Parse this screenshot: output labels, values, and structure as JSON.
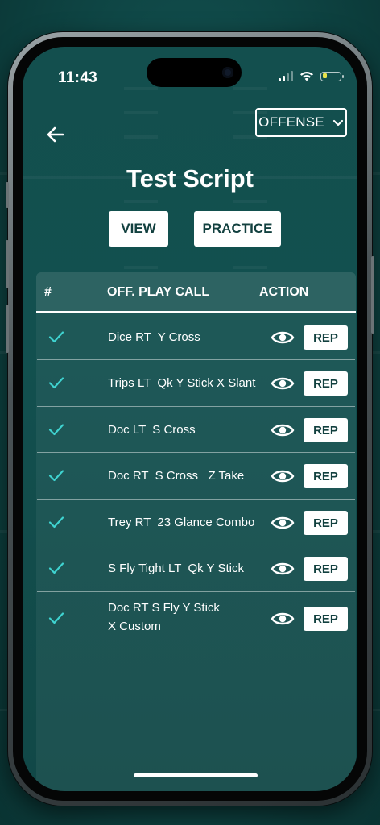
{
  "status_bar": {
    "time": "11:43"
  },
  "header": {
    "back_icon": "arrow-left-icon",
    "mode_select": {
      "label": "OFFENSE",
      "icon": "chevron-down-icon"
    },
    "title": "Test Script"
  },
  "actions": {
    "view_label": "VIEW",
    "practice_label": "PRACTICE"
  },
  "table": {
    "columns": [
      "#",
      "OFF. PLAY CALL",
      "ACTION"
    ],
    "rows": [
      {
        "play_call": "Dice RT  Y Cross",
        "rep_label": "REP",
        "checked": true
      },
      {
        "play_call": "Trips LT  Qk Y Stick X Slant",
        "rep_label": "REP",
        "checked": true
      },
      {
        "play_call": "Doc LT  S Cross",
        "rep_label": "REP",
        "checked": true
      },
      {
        "play_call": "Doc RT  S Cross   Z Take",
        "rep_label": "REP",
        "checked": true
      },
      {
        "play_call": "Trey RT  23 Glance Combo",
        "rep_label": "REP",
        "checked": true
      },
      {
        "play_call": "S Fly Tight LT  Qk Y Stick",
        "rep_label": "REP",
        "checked": true
      },
      {
        "play_call": "Doc RT S Fly Y Stick X Custom",
        "rep_label": "REP",
        "checked": true
      }
    ]
  },
  "colors": {
    "background": "#12504f",
    "accent_check": "#3fd3d0",
    "button_text": "#12403f",
    "white": "#ffffff",
    "battery": "#e8e34a"
  }
}
